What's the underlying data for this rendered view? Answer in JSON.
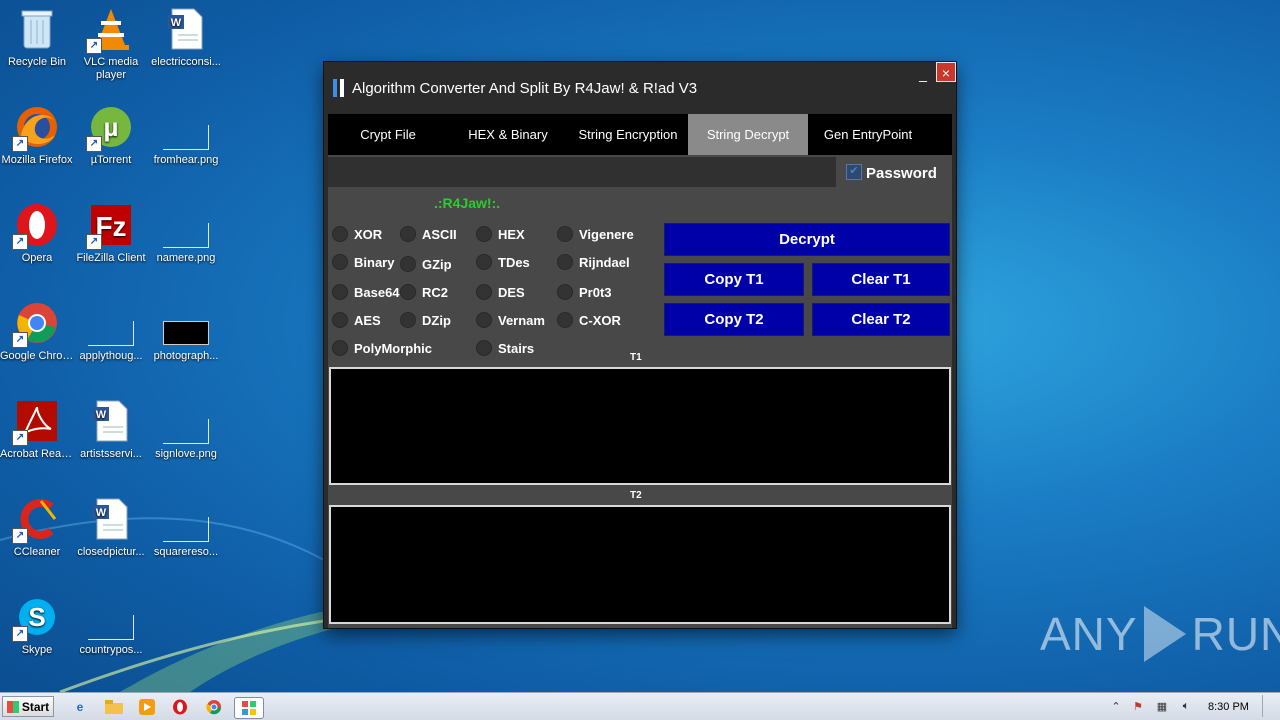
{
  "desktop": {
    "icons": [
      {
        "label": "Recycle Bin",
        "icon": "recycle-bin-icon"
      },
      {
        "label": "VLC media player",
        "icon": "vlc-icon"
      },
      {
        "label": "electricconsi...",
        "icon": "word-doc-icon"
      },
      {
        "label": "Mozilla Firefox",
        "icon": "firefox-icon"
      },
      {
        "label": "µTorrent",
        "icon": "utorrent-icon"
      },
      {
        "label": "fromhear.png",
        "icon": "image-file-icon"
      },
      {
        "label": "Opera",
        "icon": "opera-icon"
      },
      {
        "label": "FileZilla Client",
        "icon": "filezilla-icon"
      },
      {
        "label": "namere.png",
        "icon": "image-file-icon"
      },
      {
        "label": "Google Chrome",
        "icon": "chrome-icon"
      },
      {
        "label": "applythoug...",
        "icon": "image-file-icon"
      },
      {
        "label": "photograph...",
        "icon": "image-file-icon"
      },
      {
        "label": "Acrobat Reader DC",
        "icon": "acrobat-icon"
      },
      {
        "label": "artistsservi...",
        "icon": "word-doc-icon"
      },
      {
        "label": "signlove.png",
        "icon": "image-file-icon"
      },
      {
        "label": "CCleaner",
        "icon": "ccleaner-icon"
      },
      {
        "label": "closedpictur...",
        "icon": "word-doc-icon"
      },
      {
        "label": "squarereso...",
        "icon": "image-file-icon"
      },
      {
        "label": "Skype",
        "icon": "skype-icon"
      },
      {
        "label": "countrypos...",
        "icon": "image-file-icon"
      }
    ]
  },
  "window": {
    "title": "Algorithm Converter And Split By R4Jaw! & R!ad V3",
    "minimize": "_",
    "close": "×",
    "tabs": [
      {
        "label": "Crypt File",
        "active": false
      },
      {
        "label": "HEX & Binary",
        "active": false
      },
      {
        "label": "String Encryption",
        "active": false
      },
      {
        "label": "String Decrypt",
        "active": true
      },
      {
        "label": "Gen EntryPoint",
        "active": false
      }
    ],
    "password_label": "Password",
    "password_checked": true,
    "password_value": "",
    "brand": ".:R4Jaw!:.",
    "algorithms": [
      "XOR",
      "ASCII",
      "HEX",
      "Vigenere",
      "Binary",
      "GZip",
      "TDes",
      "Rijndael",
      "Base64",
      "RC2",
      "DES",
      "Pr0t3",
      "AES",
      "DZip",
      "Vernam",
      "C-XOR",
      "PolyMorphic",
      "Stairs"
    ],
    "buttons": {
      "decrypt": "Decrypt",
      "copy_t1": "Copy T1",
      "clear_t1": "Clear T1",
      "copy_t2": "Copy T2",
      "clear_t2": "Clear T2"
    },
    "t1_label": "T1",
    "t2_label": "T2",
    "t1_value": "",
    "t2_value": ""
  },
  "watermark": {
    "left": "ANY",
    "right": "RUN"
  },
  "taskbar": {
    "start_label": "Start",
    "clock": "8:30 PM"
  },
  "colors": {
    "accent_button": "#0000a8",
    "brand_text": "#2ecc2e",
    "active_tab": "#8a8a8a",
    "close_button": "#c8392b"
  }
}
